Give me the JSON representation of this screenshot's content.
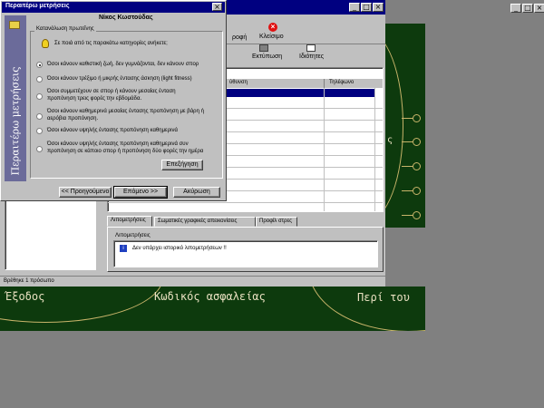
{
  "desktop": {
    "background": "#808080"
  },
  "main_window": {
    "toolbar": {
      "close_label": "Κλείσιμο",
      "partial_label": "ροφή",
      "print_label": "Εκτύπωση",
      "properties_label": "Ιδιότητες"
    },
    "table": {
      "columns": [
        "ύθυνση",
        "Τηλέφωνο"
      ]
    },
    "tabs": [
      {
        "label": "Λιπομετρήσεις"
      },
      {
        "label": "Σωματικές γραφικές απεικονίσεις"
      },
      {
        "label": "Προφίλ στρες"
      }
    ],
    "panel": {
      "title": "Λιπομετρήσεις",
      "message": "Δεν υπάρχει ιστορικό λιπομετρήσεων !!"
    },
    "status_text": "Βρέθηκε 1 πρόσωπο"
  },
  "green_panel": {
    "partial_glyph": "ς",
    "exit_label": "Έξοδος",
    "password_label": "Κωδικός ασφαλείας",
    "about_label": "Περί του"
  },
  "dialog": {
    "title": "Περαιτέρω μετρήσεις",
    "person_name": "Νίκος Κωστούδας",
    "side_label": "Περαιτέρω μετρήσεις",
    "group_label": "Κατανάλωση πρωτεΐνης",
    "question": "Σε ποιά από τις παρακάτω κατηγορίες ανήκετε;",
    "options": [
      {
        "text": "Όσοι κάνουν καθιστική ζωή, δεν γυμνάζονται, δεν κάνουν σπορ",
        "selected": true
      },
      {
        "text": "Όσοι κάνουν τρέξιμο ή μικρής έντασης άσκηση (light fitness)",
        "selected": false
      },
      {
        "text": "Όσοι συμμετέχουν σε σπορ ή κάνουν μεσαίας ένταση προπόνηση τρεις φορές την εβδομάδα.",
        "selected": false
      },
      {
        "text": "Όσοι κάνουν καθημερινά μεσαίας έντασης προπόνηση με βάρη ή αερόβια προπόνηση.",
        "selected": false
      },
      {
        "text": "Όσοι κάνουν υψηλής έντασης προπόνηση καθημερινά",
        "selected": false
      },
      {
        "text": "Όσοι κάνουν υψηλής έντασης προπόνηση καθημερινά συν προπόνηση σε κάποιο σπορ ή προπόνηση δύο φορές την ημέρα",
        "selected": false
      }
    ],
    "explain_button": "Επεξήγηση",
    "prev_button": "<< Προηγούμενο",
    "next_button": "Επόμενο >>",
    "cancel_button": "Ακύρωση"
  },
  "colors": {
    "titlebar": "#000080",
    "dialog_bg": "#c0c0c0",
    "green_panel": "#0d3a0d",
    "selection": "#000080",
    "close_icon": "#e01010"
  }
}
